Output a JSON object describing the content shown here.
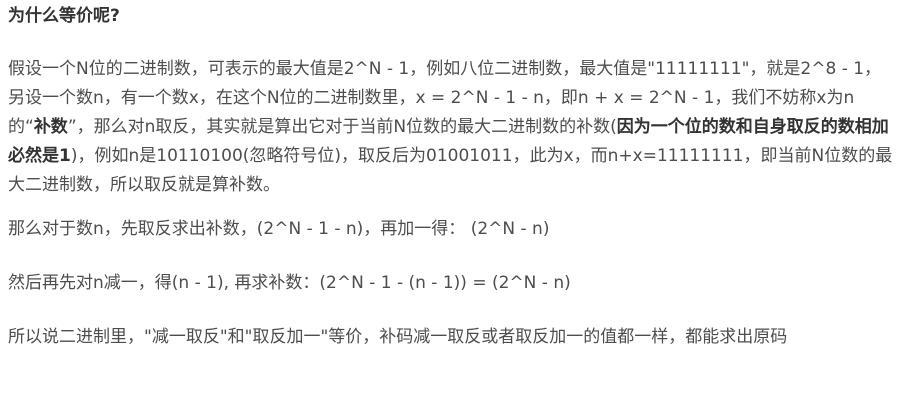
{
  "heading": "为什么等价呢?",
  "p1": {
    "t1": "假设一个N位的二进制数，可表示的最大值是2^N - 1，例如八位二进制数，最大值是\"11111111\"，就是2^8 - 1，另设一个数n，有一个数x，在这个N位的二进制数里，x = 2^N - 1 - n，即n + x = 2^N - 1，我们不妨称x为n的“",
    "b1": "补数",
    "t2": "”，那么对n取反，其实就是算出它对于当前N位数的最大二进制数的补数(",
    "b2": "因为一个位的数和自身取反的数相加必然是1",
    "t3": ")，例如n是10110100(忽略符号位)，取反后为01001011，此为x，而n+x=11111111，即当前N位数的最大二进制数，所以取反就是算补数。"
  },
  "p2": "那么对于数n，先取反求出补数，(2^N - 1 - n)，再加一得： (2^N - n)",
  "p3": "然后再先对n减一，得(n - 1), 再求补数：(2^N - 1 - (n - 1))  = (2^N - n)",
  "p4": "所以说二进制里，\"减一取反\"和\"取反加一\"等价，补码减一取反或者取反加一的值都一样，都能求出原码"
}
